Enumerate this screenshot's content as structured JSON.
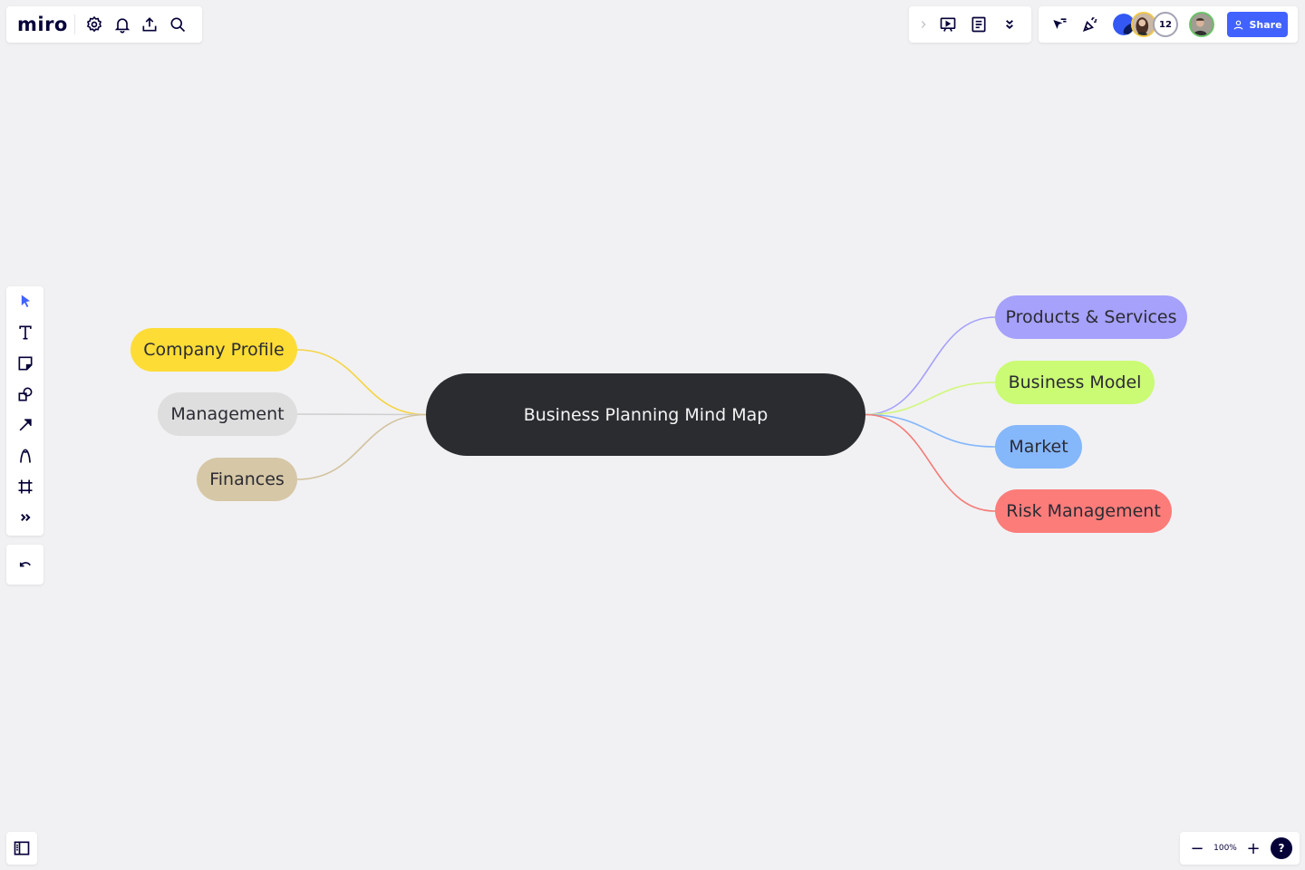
{
  "app": {
    "logo": "miro",
    "top_left_icons": [
      "settings-icon",
      "bell-icon",
      "upload-icon",
      "search-icon"
    ]
  },
  "top_right": {
    "group1_icons": [
      "chevron-right-icon",
      "presentation-icon",
      "notes-icon",
      "chevrons-down-icon"
    ],
    "group2_icons": [
      "cursor-follow-icon",
      "celebrate-icon"
    ],
    "collaborators_count": "12",
    "share_label": "Share",
    "share_color": "#4262ff"
  },
  "toolbar": {
    "tools": [
      {
        "name": "select-tool",
        "icon": "cursor-icon"
      },
      {
        "name": "text-tool",
        "icon": "text-icon"
      },
      {
        "name": "sticky-note-tool",
        "icon": "sticky-note-icon"
      },
      {
        "name": "shapes-tool",
        "icon": "shapes-icon"
      },
      {
        "name": "connection-line-tool",
        "icon": "arrow-icon"
      },
      {
        "name": "pen-tool",
        "icon": "pen-icon"
      },
      {
        "name": "frame-tool",
        "icon": "frame-icon"
      },
      {
        "name": "more-tools",
        "icon": "chevrons-right-icon"
      }
    ],
    "undo_icon": "undo-icon"
  },
  "bottom": {
    "zoom_level": "100%",
    "zoom_out_label": "−",
    "zoom_in_label": "+",
    "help_label": "?"
  },
  "mindmap": {
    "root": {
      "label": "Business Planning Mind Map",
      "color": "#2b2c30"
    },
    "left": [
      {
        "label": "Company Profile",
        "color": "#fddc36",
        "line": "#f5d443"
      },
      {
        "label": "Management",
        "color": "#dedede",
        "line": "#cfcfcf"
      },
      {
        "label": "Finances",
        "color": "#d6c7a6",
        "line": "#d2c3a0"
      }
    ],
    "right": [
      {
        "label": "Products & Services",
        "color": "#a6a1fb",
        "line": "#a6a1fb"
      },
      {
        "label": "Business Model",
        "color": "#cbfa74",
        "line": "#d2f77e"
      },
      {
        "label": "Market",
        "color": "#85b7fb",
        "line": "#85b7fb"
      },
      {
        "label": "Risk Management",
        "color": "#fc7c79",
        "line": "#f47c78"
      }
    ]
  }
}
